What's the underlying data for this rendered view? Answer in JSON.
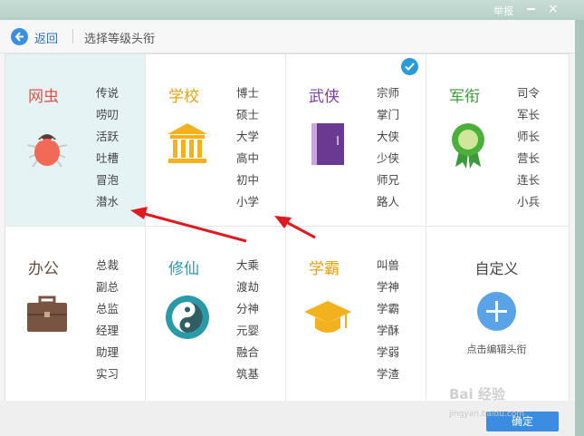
{
  "window": {
    "report_label": "举报",
    "close_label": "×"
  },
  "nav": {
    "back_label": "返回",
    "title": "选择等级头衔"
  },
  "categories": [
    {
      "title": "网虫",
      "color": "#d9544d",
      "icon": "bug-icon",
      "items": [
        "传说",
        "唠叨",
        "活跃",
        "吐槽",
        "冒泡",
        "潜水"
      ],
      "selected": true
    },
    {
      "title": "学校",
      "color": "#e2a21b",
      "icon": "school-building-icon",
      "items": [
        "博士",
        "硕士",
        "大学",
        "高中",
        "初中",
        "小学"
      ]
    },
    {
      "title": "武侠",
      "color": "#7b3f9e",
      "icon": "book-icon",
      "items": [
        "宗师",
        "掌门",
        "大侠",
        "少侠",
        "师兄",
        "路人"
      ],
      "checked": true
    },
    {
      "title": "军衔",
      "color": "#3c9a3c",
      "icon": "medal-icon",
      "items": [
        "司令",
        "军长",
        "师长",
        "营长",
        "连长",
        "小兵"
      ]
    },
    {
      "title": "办公",
      "color": "#6a4a3a",
      "icon": "briefcase-icon",
      "items": [
        "总裁",
        "副总",
        "总监",
        "经理",
        "助理",
        "实习"
      ]
    },
    {
      "title": "修仙",
      "color": "#2a9aa8",
      "icon": "taiji-icon",
      "items": [
        "大乘",
        "渡劫",
        "分神",
        "元婴",
        "融合",
        "筑基"
      ]
    },
    {
      "title": "学霸",
      "color": "#e0a010",
      "icon": "graduation-cap-icon",
      "items": [
        "叫兽",
        "学神",
        "学霸",
        "学酥",
        "学弱",
        "学渣"
      ]
    }
  ],
  "custom": {
    "title": "自定义",
    "caption": "点击编辑头衔",
    "icon": "plus-icon"
  },
  "footer": {
    "ok_label": "确定"
  },
  "watermark": {
    "text": "Bai 经验",
    "url": "jingyan.baidu.com"
  },
  "colors": {
    "accent": "#3a8de0",
    "selected_bg": "#e5f3f5",
    "arrow": "#e0191e"
  }
}
